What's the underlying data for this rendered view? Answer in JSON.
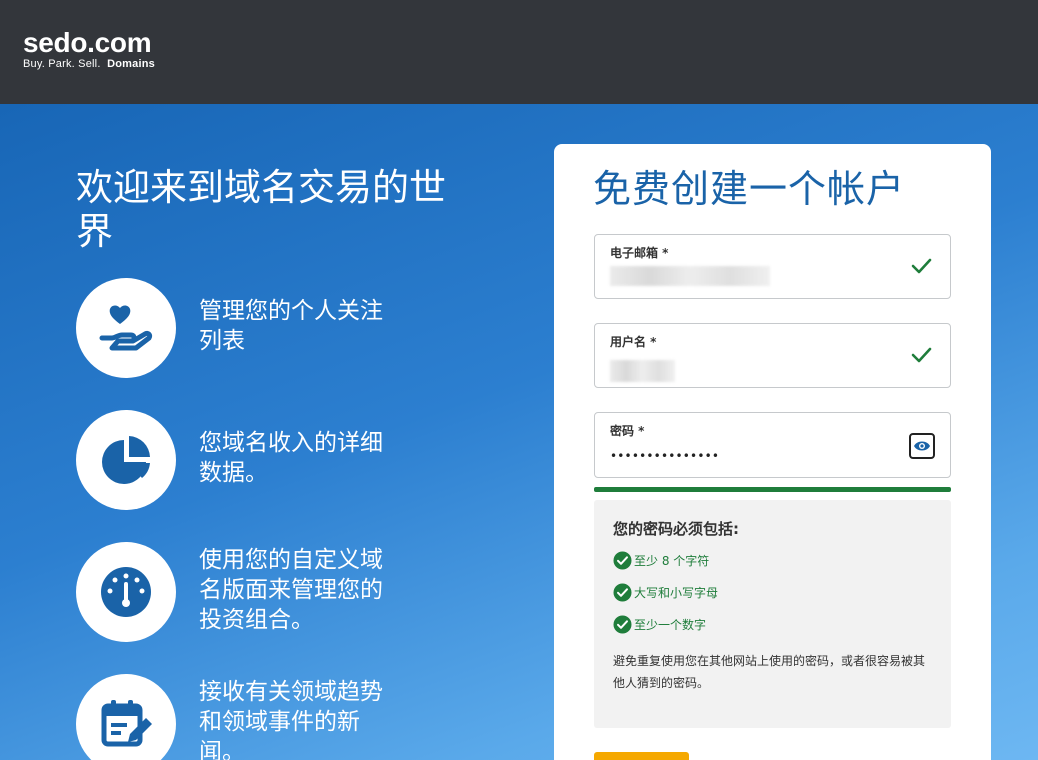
{
  "header": {
    "logo_name": "sedo.com",
    "logo_tagline_plain": "Buy.  Park.  Sell.",
    "logo_tagline_bold": "Domains",
    "background_color": "#33363b"
  },
  "hero": {
    "title": "欢迎来到域名交易的世界",
    "features": [
      {
        "icon": "heart-hand-icon",
        "text": "管理您的个人关注列表"
      },
      {
        "icon": "pie-chart-icon",
        "text": "您域名收入的详细数据。"
      },
      {
        "icon": "dashboard-gauge-icon",
        "text": "使用您的自定义域名版面来管理您的投资组合。"
      },
      {
        "icon": "calendar-edit-icon",
        "text": "接收有关领域趋势和领域事件的新闻。"
      }
    ],
    "icon_color": "#1a63a8"
  },
  "signup": {
    "title": "免费创建一个帐户",
    "email": {
      "label": "电子邮箱 *",
      "status_icon": "check-icon"
    },
    "username": {
      "label": "用户名 *",
      "status_icon": "check-icon"
    },
    "password": {
      "label": "密码 *",
      "value": "•••••••••••••••",
      "toggle_icon": "eye-icon"
    },
    "strength_color": "#1f7d3b",
    "requirements": {
      "title": "您的密码必须包括:",
      "items": [
        {
          "text": "至少 8 个字符",
          "icon": "check-circle-icon"
        },
        {
          "text": "大写和小写字母",
          "icon": "check-circle-icon"
        },
        {
          "text": "至少一个数字",
          "icon": "check-circle-icon"
        }
      ],
      "note": "避免重复使用您在其他网站上使用的密码，或者很容易被其他人猜到的密码。"
    },
    "submit_color": "#f5a800"
  }
}
